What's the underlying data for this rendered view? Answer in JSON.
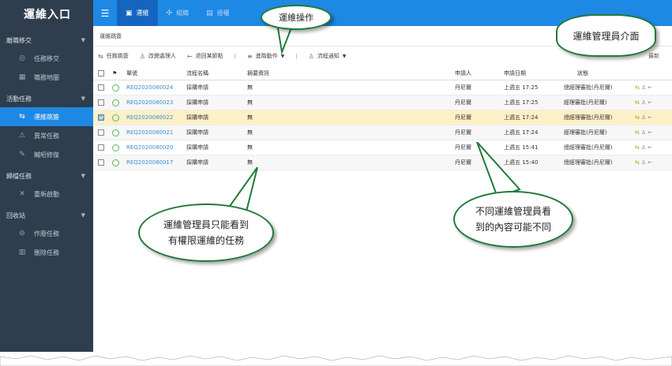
{
  "sidebar": {
    "brand": "運維入口",
    "groups": [
      {
        "label": "離職移交",
        "items": [
          {
            "label": "任務移交",
            "icon": "swap-icon"
          },
          {
            "label": "職務地圖",
            "icon": "map-icon"
          }
        ]
      },
      {
        "label": "活動任務",
        "items": [
          {
            "label": "運維跳簽",
            "icon": "flow-icon",
            "active": true
          },
          {
            "label": "異常任務",
            "icon": "warning-icon"
          },
          {
            "label": "贓昭修復",
            "icon": "wrench-icon"
          }
        ]
      },
      {
        "label": "歸檔任務",
        "items": [
          {
            "label": "重新啟動",
            "icon": "tool-icon"
          }
        ]
      },
      {
        "label": "回收站",
        "items": [
          {
            "label": "作廢任務",
            "icon": "ban-icon"
          },
          {
            "label": "刪除任務",
            "icon": "trash-icon"
          }
        ]
      }
    ]
  },
  "topbar": {
    "menu_icon": "☰",
    "tabs": [
      {
        "label": "運維",
        "icon": "dashboard-icon",
        "active": true
      },
      {
        "label": "組織",
        "icon": "org-icon"
      },
      {
        "label": "授權",
        "icon": "auth-icon"
      }
    ]
  },
  "breadcrumb": "運維跳簽",
  "toolbar": {
    "jump": "任務跳簽",
    "change_handler": "改變處理人",
    "return_node": "退回某節點",
    "advanced": "進階動作",
    "notify": "流程通知",
    "end_label": "最新"
  },
  "table": {
    "headers": {
      "no": "單號",
      "process": "流程名稱",
      "summary": "摘要資訊",
      "applicant": "申請人",
      "date": "申請日期",
      "status": "狀態"
    },
    "rows": [
      {
        "no": "REQ2020080024",
        "process": "採購申請",
        "summary": "無",
        "applicant": "丹尼爾",
        "date": "上週五 17:25",
        "status": "總經理審批(丹尼爾)"
      },
      {
        "no": "REQ2020080023",
        "process": "採購申請",
        "summary": "無",
        "applicant": "丹尼爾",
        "date": "上週五 17:25",
        "status": "經理審批(丹尼爾)"
      },
      {
        "no": "REQ2020080022",
        "process": "採購申請",
        "summary": "無",
        "applicant": "丹尼爾",
        "date": "上週五 17:24",
        "status": "總經理審批(丹尼爾)",
        "selected": true
      },
      {
        "no": "REQ2020080021",
        "process": "採購申請",
        "summary": "無",
        "applicant": "丹尼爾",
        "date": "上週五 17:24",
        "status": "經理審批(丹尼爾)"
      },
      {
        "no": "REQ2020080020",
        "process": "採購申請",
        "summary": "無",
        "applicant": "丹尼爾",
        "date": "上週五 15:41",
        "status": "總經理審批(丹尼爾)"
      },
      {
        "no": "REQ2020080017",
        "process": "採購申請",
        "summary": "無",
        "applicant": "丹尼爾",
        "date": "上週五 15:40",
        "status": "總經理審批(丹尼爾)"
      }
    ]
  },
  "callouts": {
    "ops_action": "運維操作",
    "admin_ui": "運維管理員介面",
    "admin_scope_line1": "運維管理員只能看到",
    "admin_scope_line2": "有權限運維的任務",
    "diff_line1": "不同運維管理員看",
    "diff_line2": "到的內容可能不同"
  },
  "colors": {
    "accent": "#1e88e5",
    "sidebar": "#2f3e4e",
    "selected_row": "#fdf0c6",
    "callout_border": "#1f7b3a",
    "link": "#3a8fd6"
  }
}
